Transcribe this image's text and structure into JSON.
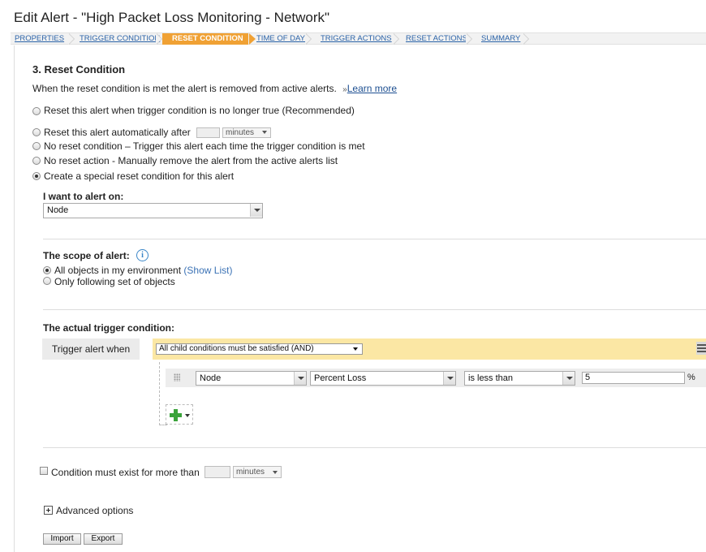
{
  "window": {
    "title": "Edit Alert - \"High Packet Loss Monitoring - Network\""
  },
  "wizard": {
    "steps": [
      {
        "label": "PROPERTIES",
        "active": false
      },
      {
        "label": "TRIGGER CONDITION",
        "active": false
      },
      {
        "label": "RESET CONDITION",
        "active": true
      },
      {
        "label": "TIME OF DAY",
        "active": false
      },
      {
        "label": "TRIGGER ACTIONS",
        "active": false
      },
      {
        "label": "RESET ACTIONS",
        "active": false
      },
      {
        "label": "SUMMARY",
        "active": false
      }
    ],
    "active_color": "#f0a134"
  },
  "section": {
    "title": "3. Reset Condition",
    "description": "When the reset condition is met the alert is removed from active alerts.",
    "learn_more_prefix": "»",
    "learn_more": "Learn more"
  },
  "reset_options": [
    {
      "label": "Reset this alert when trigger condition is no longer true (Recommended)",
      "checked": false
    },
    {
      "label": "Reset this alert automatically after",
      "checked": false,
      "input_value": "",
      "unit": "minutes"
    },
    {
      "label": "No reset condition – Trigger this alert each time the trigger condition is met",
      "checked": false
    },
    {
      "label": "No reset action - Manually remove the alert from the active alerts list",
      "checked": false
    },
    {
      "label": "Create a special reset condition for this alert",
      "checked": true
    }
  ],
  "alert_on": {
    "label": "I want to alert on:",
    "value": "Node"
  },
  "scope": {
    "label": "The scope of alert:",
    "info_icon": "info-icon",
    "options": [
      {
        "label": "All objects in my environment",
        "link": "(Show List)",
        "checked": true
      },
      {
        "label": "Only following set of objects",
        "checked": false
      }
    ]
  },
  "trigger": {
    "heading": "The actual trigger condition:",
    "when_label": "Trigger alert when",
    "logic_select": "All child conditions must be satisfied (AND)",
    "menu_icon": "hamburger-menu-icon",
    "bar_color": "#fbe7a4",
    "condition": {
      "object": "Node",
      "field": "Percent Loss",
      "operator": "is less than",
      "value": "5",
      "unit": "%"
    },
    "add_icon": "add-plus-icon"
  },
  "duration": {
    "label": "Condition must exist for more than",
    "input_value": "",
    "unit": "minutes"
  },
  "advanced": {
    "label": "Advanced options",
    "icon": "plus-expand-icon"
  },
  "buttons": {
    "import": "Import",
    "export": "Export"
  }
}
